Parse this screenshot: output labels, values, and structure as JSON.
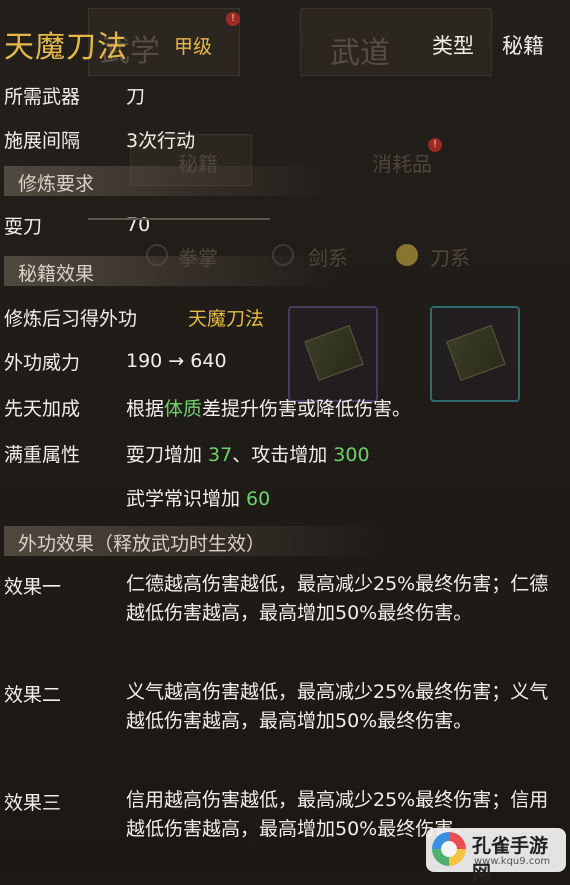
{
  "skill": {
    "name": "天魔刀法",
    "grade": "甲级"
  },
  "header": {
    "type_label": "类型",
    "secret_label": "秘籍"
  },
  "background": {
    "wuxue_tab": "武学",
    "wudao_tab": "武道",
    "secret_tab": "秘籍",
    "consumable_tab": "消耗品",
    "filter_fist": "拳掌",
    "filter_sword": "剑系",
    "filter_blade": "刀系"
  },
  "info": {
    "weapon_label": "所需武器",
    "weapon_value": "刀",
    "interval_label": "施展间隔",
    "interval_value": "3次行动"
  },
  "requirement": {
    "section_title": "修炼要求",
    "stat_label": "耍刀",
    "stat_value": "70"
  },
  "secret_effect": {
    "section_title": "秘籍效果",
    "learn_label": "修炼后习得外功",
    "learn_value": "天魔刀法",
    "power_label": "外功威力",
    "power_value": "190 → 640",
    "innate_label": "先天加成",
    "innate_prefix": "根据",
    "innate_stat": "体质",
    "innate_suffix": "差提升伤害或降低伤害。",
    "full_label": "满重属性",
    "full_line1_a": "耍刀增加 ",
    "full_line1_a_val": "37",
    "full_line1_b": "、攻击增加 ",
    "full_line1_b_val": "300",
    "full_line2": "武学常识增加 ",
    "full_line2_val": "60"
  },
  "external_effect": {
    "section_title": "外功效果（释放武功时生效）",
    "effects": [
      {
        "label": "效果一",
        "text": "仁德越高伤害越低，最高减少25%最终伤害；仁德越低伤害越高，最高增加50%最终伤害。"
      },
      {
        "label": "效果二",
        "text": "义气越高伤害越低，最高减少25%最终伤害；义气越低伤害越高，最高增加50%最终伤害。"
      },
      {
        "label": "效果三",
        "text": "信用越高伤害越低，最高减少25%最终伤害；信用越低伤害越高，最高增加50%最终伤害。"
      }
    ]
  },
  "watermark": {
    "name": "孔雀手游网",
    "url": "www.kqu9.com"
  }
}
